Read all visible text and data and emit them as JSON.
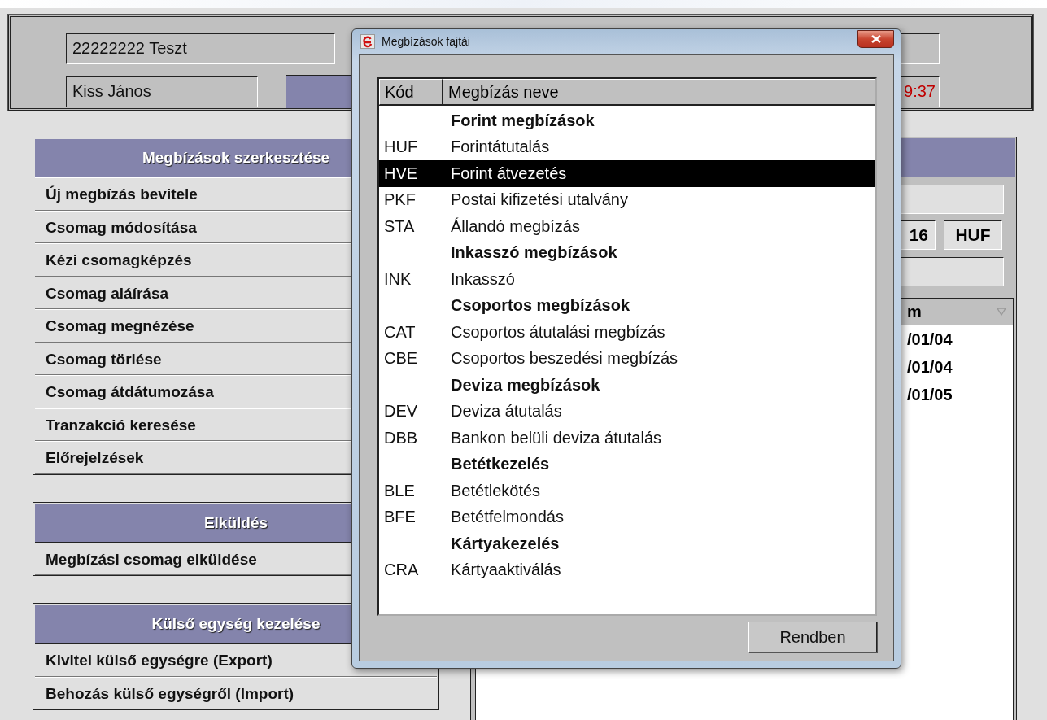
{
  "header": {
    "account": "22222222 Teszt",
    "user": "Kiss János",
    "time": "9:37"
  },
  "menu_groups": [
    {
      "title": "Megbízások szerkesztése",
      "items": [
        "Új megbízás bevitele",
        "Csomag módosítása",
        "Kézi csomagképzés",
        "Csomag aláírása",
        "Csomag megnézése",
        "Csomag törlése",
        "Csomag átdátumozása",
        "Tranzakció keresése",
        "Előrejelzések"
      ]
    },
    {
      "title": "Elküldés",
      "items": [
        "Megbízási csomag elküldése"
      ]
    },
    {
      "title": "Külső egység kezelése",
      "items": [
        "Kivitel külső egységre (Export)",
        "Behozás külső egységről (Import)"
      ]
    }
  ],
  "detail": {
    "amount_tail": "16",
    "currency": "HUF",
    "column_header": "m",
    "rows": [
      "/01/04",
      "/01/04",
      "/01/05"
    ]
  },
  "dialog": {
    "title": "Megbízások fajtái",
    "columns": [
      "Kód",
      "Megbízás neve"
    ],
    "rows": [
      {
        "kind": "group",
        "name": "Forint megbízások",
        "selected": false
      },
      {
        "kind": "item",
        "code": "HUF",
        "name": "Forintátutalás",
        "selected": false
      },
      {
        "kind": "item",
        "code": "HVE",
        "name": "Forint átvezetés",
        "selected": true
      },
      {
        "kind": "item",
        "code": "PKF",
        "name": "Postai kifizetési utalvány",
        "selected": false
      },
      {
        "kind": "item",
        "code": "STA",
        "name": "Állandó megbízás",
        "selected": false
      },
      {
        "kind": "group",
        "name": "Inkasszó megbízások",
        "selected": false
      },
      {
        "kind": "item",
        "code": "INK",
        "name": "Inkasszó",
        "selected": false
      },
      {
        "kind": "group",
        "name": "Csoportos megbízások",
        "selected": false
      },
      {
        "kind": "item",
        "code": "CAT",
        "name": "Csoportos átutalási megbízás",
        "selected": false
      },
      {
        "kind": "item",
        "code": "CBE",
        "name": "Csoportos beszedési megbízás",
        "selected": false
      },
      {
        "kind": "group",
        "name": "Deviza megbízások",
        "selected": false
      },
      {
        "kind": "item",
        "code": "DEV",
        "name": "Deviza átutalás",
        "selected": false
      },
      {
        "kind": "item",
        "code": "DBB",
        "name": "Bankon belüli deviza átutalás",
        "selected": false
      },
      {
        "kind": "group",
        "name": "Betétkezelés",
        "selected": false
      },
      {
        "kind": "item",
        "code": "BLE",
        "name": "Betétlekötés",
        "selected": false
      },
      {
        "kind": "item",
        "code": "BFE",
        "name": "Betétfelmondás",
        "selected": false
      },
      {
        "kind": "group",
        "name": "Kártyakezelés",
        "selected": false
      },
      {
        "kind": "item",
        "code": "CRA",
        "name": "Kártyaaktiválás",
        "selected": false
      }
    ],
    "ok_button": "Rendben"
  }
}
